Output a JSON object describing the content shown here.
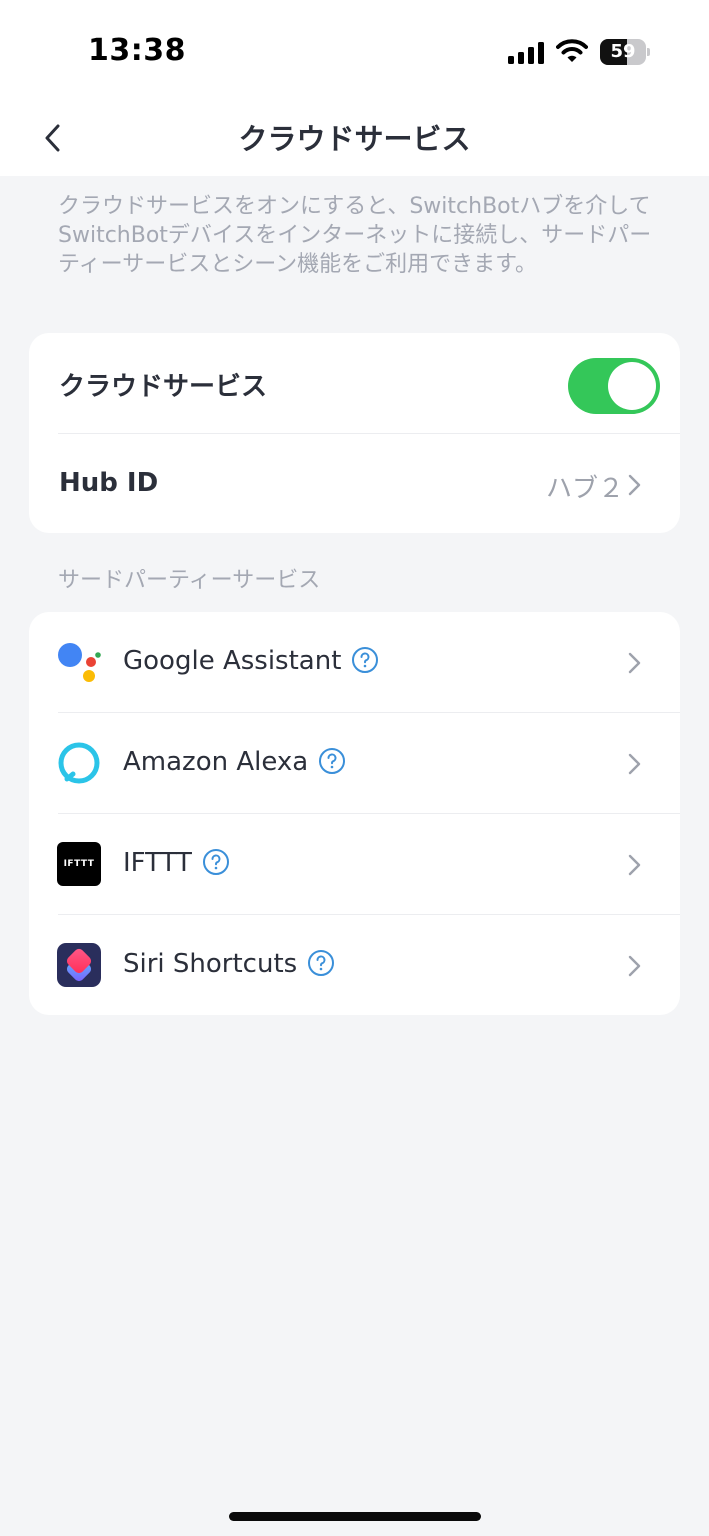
{
  "status_bar": {
    "time": "13:38",
    "battery_level": 59,
    "battery_text": "59"
  },
  "nav": {
    "title": "クラウドサービス",
    "back_icon": "chevron-left-icon"
  },
  "description": "クラウドサービスをオンにすると、SwitchBotハブを介してSwitchBotデバイスをインターネットに接続し、サードパーティーサービスとシーン機能をご利用できます。",
  "cloud_card": {
    "cloud_service_label": "クラウドサービス",
    "cloud_service_enabled": true,
    "hub_id_label": "Hub ID",
    "hub_id_value": "ハブ２"
  },
  "third_party": {
    "section_label": "サードパーティーサービス",
    "items": [
      {
        "label": "Google Assistant",
        "icon": "google-assistant-icon"
      },
      {
        "label": "Amazon Alexa",
        "icon": "alexa-icon"
      },
      {
        "label": "IFTTT",
        "icon": "ifttt-icon",
        "icon_text": "IFTTT"
      },
      {
        "label": "Siri Shortcuts",
        "icon": "shortcuts-icon"
      }
    ]
  },
  "colors": {
    "accent": "#3a8fd9",
    "toggle_on": "#34c759",
    "background": "#f4f5f7",
    "card": "#ffffff"
  }
}
